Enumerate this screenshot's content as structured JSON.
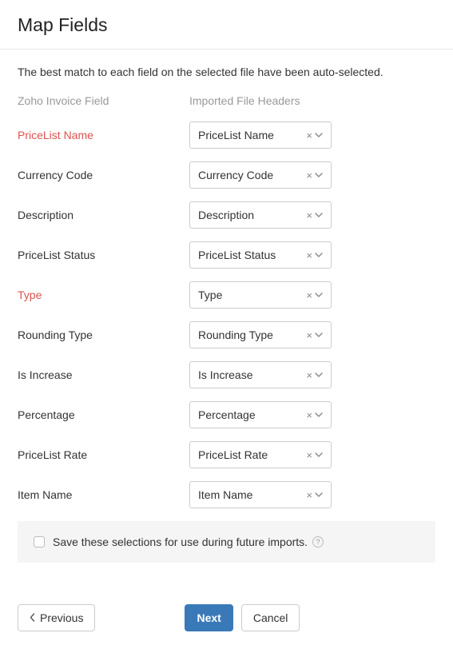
{
  "title": "Map Fields",
  "intro": "The best match to each field on the selected file have been auto-selected.",
  "columns": {
    "left": "Zoho Invoice Field",
    "right": "Imported File Headers"
  },
  "fields": [
    {
      "label": "PriceList Name",
      "required": true,
      "value": "PriceList Name"
    },
    {
      "label": "Currency Code",
      "required": false,
      "value": "Currency Code"
    },
    {
      "label": "Description",
      "required": false,
      "value": "Description"
    },
    {
      "label": "PriceList Status",
      "required": false,
      "value": "PriceList Status"
    },
    {
      "label": "Type",
      "required": true,
      "value": "Type"
    },
    {
      "label": "Rounding Type",
      "required": false,
      "value": "Rounding Type"
    },
    {
      "label": "Is Increase",
      "required": false,
      "value": "Is Increase"
    },
    {
      "label": "Percentage",
      "required": false,
      "value": "Percentage"
    },
    {
      "label": "PriceList Rate",
      "required": false,
      "value": "PriceList Rate"
    },
    {
      "label": "Item Name",
      "required": false,
      "value": "Item Name"
    }
  ],
  "save_selections_label": "Save these selections for use during future imports.",
  "buttons": {
    "previous": "Previous",
    "next": "Next",
    "cancel": "Cancel"
  }
}
